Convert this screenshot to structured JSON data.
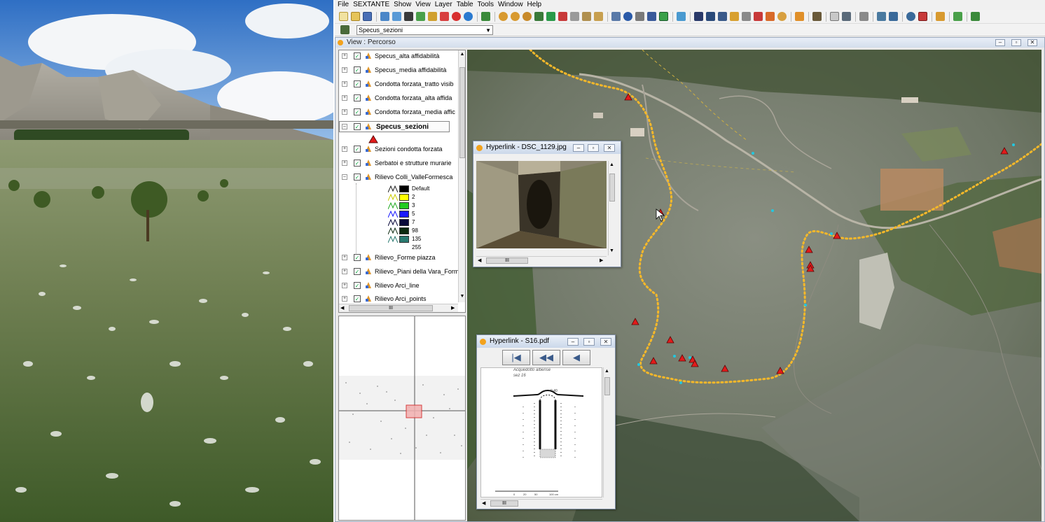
{
  "menu": [
    "File",
    "SEXTANTE",
    "Show",
    "View",
    "Layer",
    "Table",
    "Tools",
    "Window",
    "Help"
  ],
  "active_layer": "Specus_sezioni",
  "view_title": "View : Percorso",
  "toc": {
    "layers_top": [
      {
        "label": "Specus_alta affidabilità"
      },
      {
        "label": "Specus_media affidabilità"
      },
      {
        "label": "Condotta forzata_tratto visib"
      },
      {
        "label": "Condotta forzata_alta affida"
      },
      {
        "label": "Condotta forzata_media affic"
      }
    ],
    "selected_layer": "Specus_sezioni",
    "layers_mid": [
      {
        "label": "Sezioni condotta forzata"
      },
      {
        "label": "Serbatoi e strutture murarie"
      },
      {
        "label": "Rilievo Colli_ValleFormesca"
      }
    ],
    "legend": [
      {
        "value": "Default",
        "color": "#000000"
      },
      {
        "value": "2",
        "color": "#ffff00"
      },
      {
        "value": "3",
        "color": "#22cc22"
      },
      {
        "value": "5",
        "color": "#1a1aff"
      },
      {
        "value": "7",
        "color": "#0a0a3a"
      },
      {
        "value": "98",
        "color": "#0d2a10"
      },
      {
        "value": "135",
        "color": "#2a7a70"
      },
      {
        "value": "255",
        "color": "#ffffff"
      }
    ],
    "layers_bottom": [
      {
        "label": "Rilievo_Forme piazza"
      },
      {
        "label": "Rilievo_Piani della Vara_Form"
      },
      {
        "label": "Rilievo Arci_line"
      },
      {
        "label": "Rilievo Arci_points"
      }
    ],
    "scroll_glyph": "III"
  },
  "hyperlink_photo": {
    "title": "Hyperlink - DSC_1129.jpg"
  },
  "hyperlink_pdf": {
    "title": "Hyperlink - S16.pdf",
    "doc_title": "Acquedotto albense",
    "doc_subtitle": "sez 16",
    "dimension": "0.40",
    "scale_labels": [
      "0",
      "20",
      "50",
      "100 cm"
    ]
  },
  "colors": {
    "route": "#f5b82a",
    "marker": "#e31a1a",
    "titlebar": "#d4deec"
  }
}
